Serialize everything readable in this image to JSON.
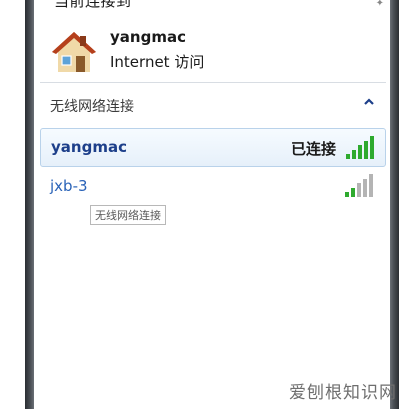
{
  "header": {
    "title": "当前连接到"
  },
  "current_connection": {
    "name": "yangmac",
    "access": "Internet 访问",
    "icon": "house-icon"
  },
  "wireless_section": {
    "label": "无线网络连接",
    "collapse_icon": "chevron-up-icon"
  },
  "networks": [
    {
      "name": "yangmac",
      "status": "已连接",
      "signal_bars_total": 5,
      "signal_bars_active": 5
    },
    {
      "name": "jxb-3",
      "status": "",
      "signal_bars_total": 5,
      "signal_bars_active": 2
    }
  ],
  "tooltip": {
    "text": "无线网络连接"
  },
  "watermark": {
    "text": "爱刨根知识网"
  },
  "colors": {
    "signal_active": "#2eaa2e",
    "signal_inactive": "#b4b4b4",
    "selected_row_bg": "#e6f0fa",
    "network_link": "#2a63b8"
  }
}
